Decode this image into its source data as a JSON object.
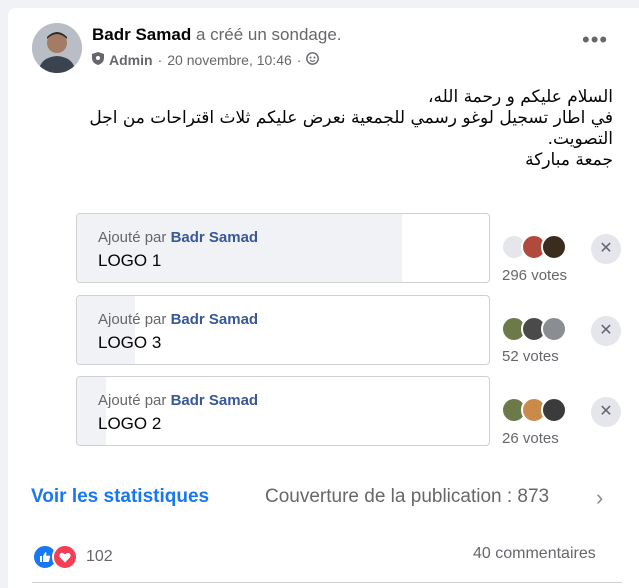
{
  "post": {
    "author": "Badr Samad",
    "action": "a créé un sondage.",
    "role": "Admin",
    "timestamp": "20 novembre, 10:46",
    "separator": "·",
    "more_label": "•••",
    "text_lines": [
      "السلام عليكم و رحمة الله،",
      "في اطار تسجيل لوغو رسمي للجمعية نعرض عليكم ثلاث اقتراحات من اجل",
      "التصويت.",
      "جمعة مباركة"
    ]
  },
  "poll": {
    "added_by_label": "Ajouté par",
    "options": [
      {
        "added_by": "Badr Samad",
        "label": "LOGO 1",
        "votes_text": "296 votes",
        "votes": 296,
        "share": 0.79
      },
      {
        "added_by": "Badr Samad",
        "label": "LOGO 3",
        "votes_text": "52 votes",
        "votes": 52,
        "share": 0.14
      },
      {
        "added_by": "Badr Samad",
        "label": "LOGO 2",
        "votes_text": "26 votes",
        "votes": 26,
        "share": 0.07
      }
    ],
    "remove_label": "✕"
  },
  "footer": {
    "stats_link": "Voir les statistiques",
    "reach": "Couverture de la publication : 873",
    "chevron": "›",
    "reaction_count": "102",
    "comments": "40 commentaires"
  },
  "colors": {
    "link": "#1877f2",
    "name_link": "#385898",
    "secondary_text": "#65676b",
    "like": "#1877f2",
    "love": "#f33e58",
    "vote_fill": "#f0f2f5"
  }
}
